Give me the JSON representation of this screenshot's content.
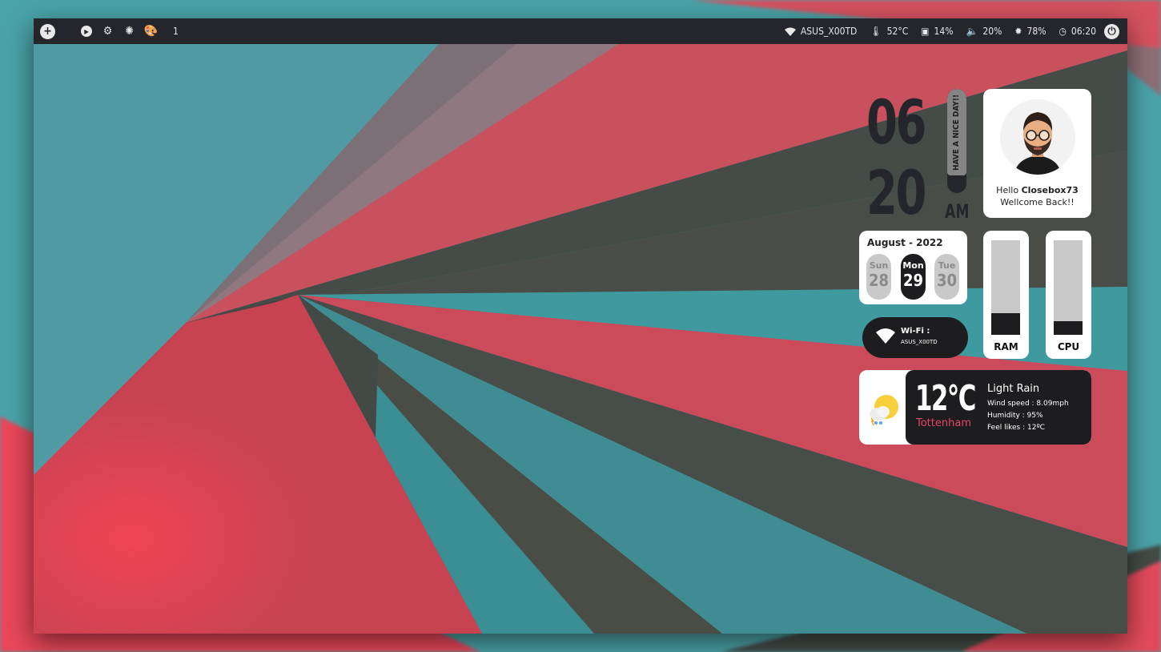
{
  "topbar": {
    "workspace": "1",
    "wifi_name": "ASUS_X00TD",
    "temperature": "52°C",
    "cpu": "14%",
    "volume": "20%",
    "brightness": "78%",
    "time": "06:20"
  },
  "clock": {
    "hour": "06",
    "minute": "20",
    "ampm": "AM",
    "message": "HAVE A NICE DAY!!"
  },
  "profile": {
    "greeting": "Hello",
    "username": "Closebox73",
    "welcome": "Wellcome Back!!"
  },
  "calendar": {
    "title": "August - 2022",
    "days": [
      {
        "name": "Sun",
        "date": "28"
      },
      {
        "name": "Mon",
        "date": "29"
      },
      {
        "name": "Tue",
        "date": "30"
      }
    ]
  },
  "meters": {
    "ram_label": "RAM",
    "ram_fraction": 0.23,
    "cpu_label": "CPU",
    "cpu_fraction": 0.14
  },
  "wifi": {
    "title": "Wi-Fi :",
    "ssid": "ASUS_X00TD"
  },
  "weather": {
    "temp": "12°C",
    "city": "Tottenham",
    "condition": "Light Rain",
    "wind": "Wind speed : 8.09mph",
    "humidity": "Humidity : 95%",
    "feels": "Feel likes : 12ºC"
  },
  "colors": {
    "accent": "#e8446a",
    "dark": "#1d1d1f",
    "bar": "#25262b"
  }
}
